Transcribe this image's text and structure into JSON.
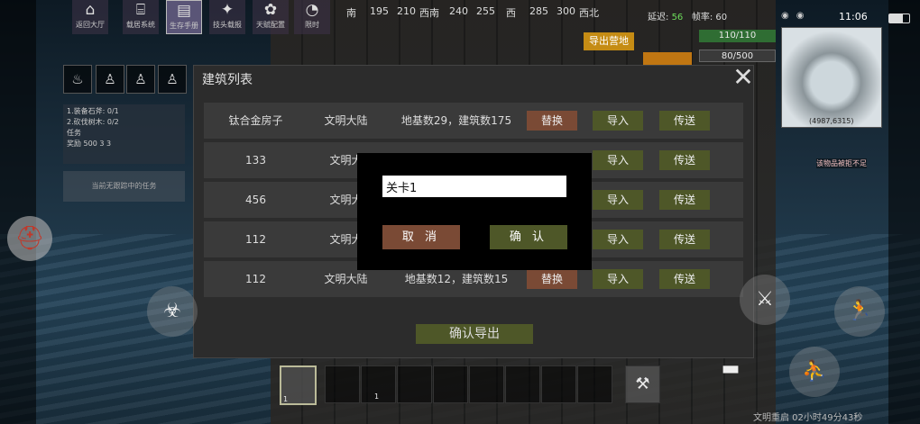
{
  "top_nav": [
    {
      "label": "返回大厅",
      "icon": "house-icon"
    },
    {
      "label": "载居系统",
      "icon": "building-icon"
    },
    {
      "label": "生存手册",
      "icon": "book-icon"
    },
    {
      "label": "技头载报",
      "icon": "craft-icon"
    },
    {
      "label": "天赋配置",
      "icon": "talent-icon"
    },
    {
      "label": "限时",
      "icon": "timer-icon"
    }
  ],
  "compass": [
    "南",
    "195",
    "210",
    "西南",
    "240",
    "255",
    "西",
    "285",
    "300",
    "西北"
  ],
  "status": {
    "latency_label": "延迟:",
    "latency_value": "56",
    "fps_label": "帧率:",
    "fps_value": "60"
  },
  "clock": "11:06",
  "hp": "110/110",
  "food": "80/500",
  "export_position": "导出营地",
  "minimap_coords": "(4987,6315)",
  "quest": {
    "line1": "1.装备石斧: 0/1",
    "line2": "2.砍伐树木: 0/2",
    "task_label": "任务",
    "reward_label": "奖励",
    "reward_values": [
      "500",
      "3",
      "3"
    ],
    "track_text": "当前无跟踪中的任务"
  },
  "warning_text": "该物品被拒不足",
  "dialog": {
    "title": "建筑列表",
    "close": "✕",
    "rows": [
      {
        "name": "钛合金房子",
        "region": "文明大陆",
        "info": "地基数29，建筑数175",
        "replace": "替换",
        "import": "导入",
        "send": "传送"
      },
      {
        "name": "133",
        "region": "文明大",
        "info": "",
        "replace": "",
        "import": "导入",
        "send": "传送"
      },
      {
        "name": "456",
        "region": "文明大",
        "info": "",
        "replace": "",
        "import": "导入",
        "send": "传送"
      },
      {
        "name": "112",
        "region": "文明大",
        "info": "",
        "replace": "",
        "import": "导入",
        "send": "传送"
      },
      {
        "name": "112",
        "region": "文明大陆",
        "info": "地基数12，建筑数15",
        "replace": "替换",
        "import": "导入",
        "send": "传送"
      }
    ],
    "confirm_export": "确认导出"
  },
  "modal": {
    "input_value": "关卡1",
    "cancel": "取 消",
    "ok": "确 认"
  },
  "hotbar_counts": {
    "slot0": "1",
    "slot2": "1"
  },
  "footer": "文明重启 02小时49分43秒"
}
